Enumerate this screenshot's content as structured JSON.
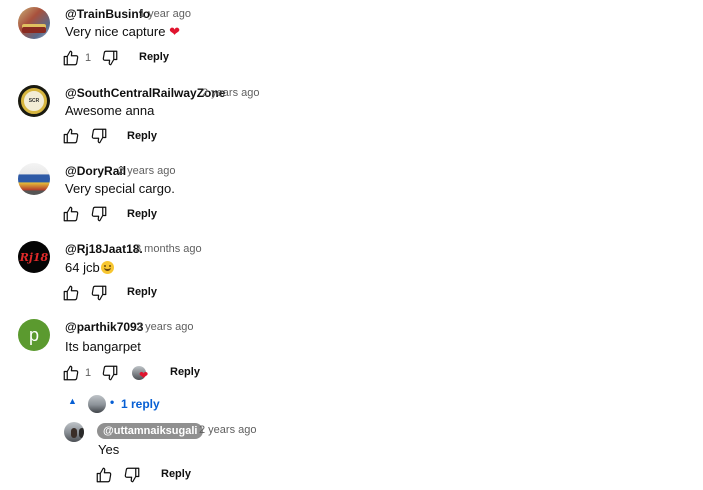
{
  "comments": [
    {
      "author": "@TrainBusinfo",
      "time": "1 year ago",
      "text": "Very nice capture",
      "like_count": "1",
      "reply_label": "Reply"
    },
    {
      "author": "@SouthCentralRailwayZone",
      "time": "2 years ago",
      "text": "Awesome anna",
      "reply_label": "Reply"
    },
    {
      "author": "@DoryRail",
      "time": "2 years ago",
      "text": "Very special cargo.",
      "reply_label": "Reply"
    },
    {
      "author": "@Rj18Jaat18.",
      "time": "3 months ago",
      "text": "64 jcb",
      "avatar_text": "Rj18",
      "reply_label": "Reply"
    },
    {
      "author": "@parthik7093",
      "time": "2 years ago",
      "text": "Its bangarpet",
      "avatar_letter": "p",
      "like_count": "1",
      "reply_label": "Reply"
    }
  ],
  "replies_toggle": {
    "label": "1 reply",
    "separator": "•"
  },
  "reply": {
    "author": "@uttamnaiksugali",
    "time": "2 years ago",
    "text": "Yes",
    "reply_label": "Reply"
  },
  "icons": {
    "like": "thumb-up-icon",
    "dislike": "thumb-down-icon",
    "heart": "heart-icon",
    "caret": "caret-up-icon"
  },
  "colors": {
    "link_blue": "#065fd4",
    "heart_red": "#e0142e",
    "avatar_green": "#5b9a2f"
  }
}
